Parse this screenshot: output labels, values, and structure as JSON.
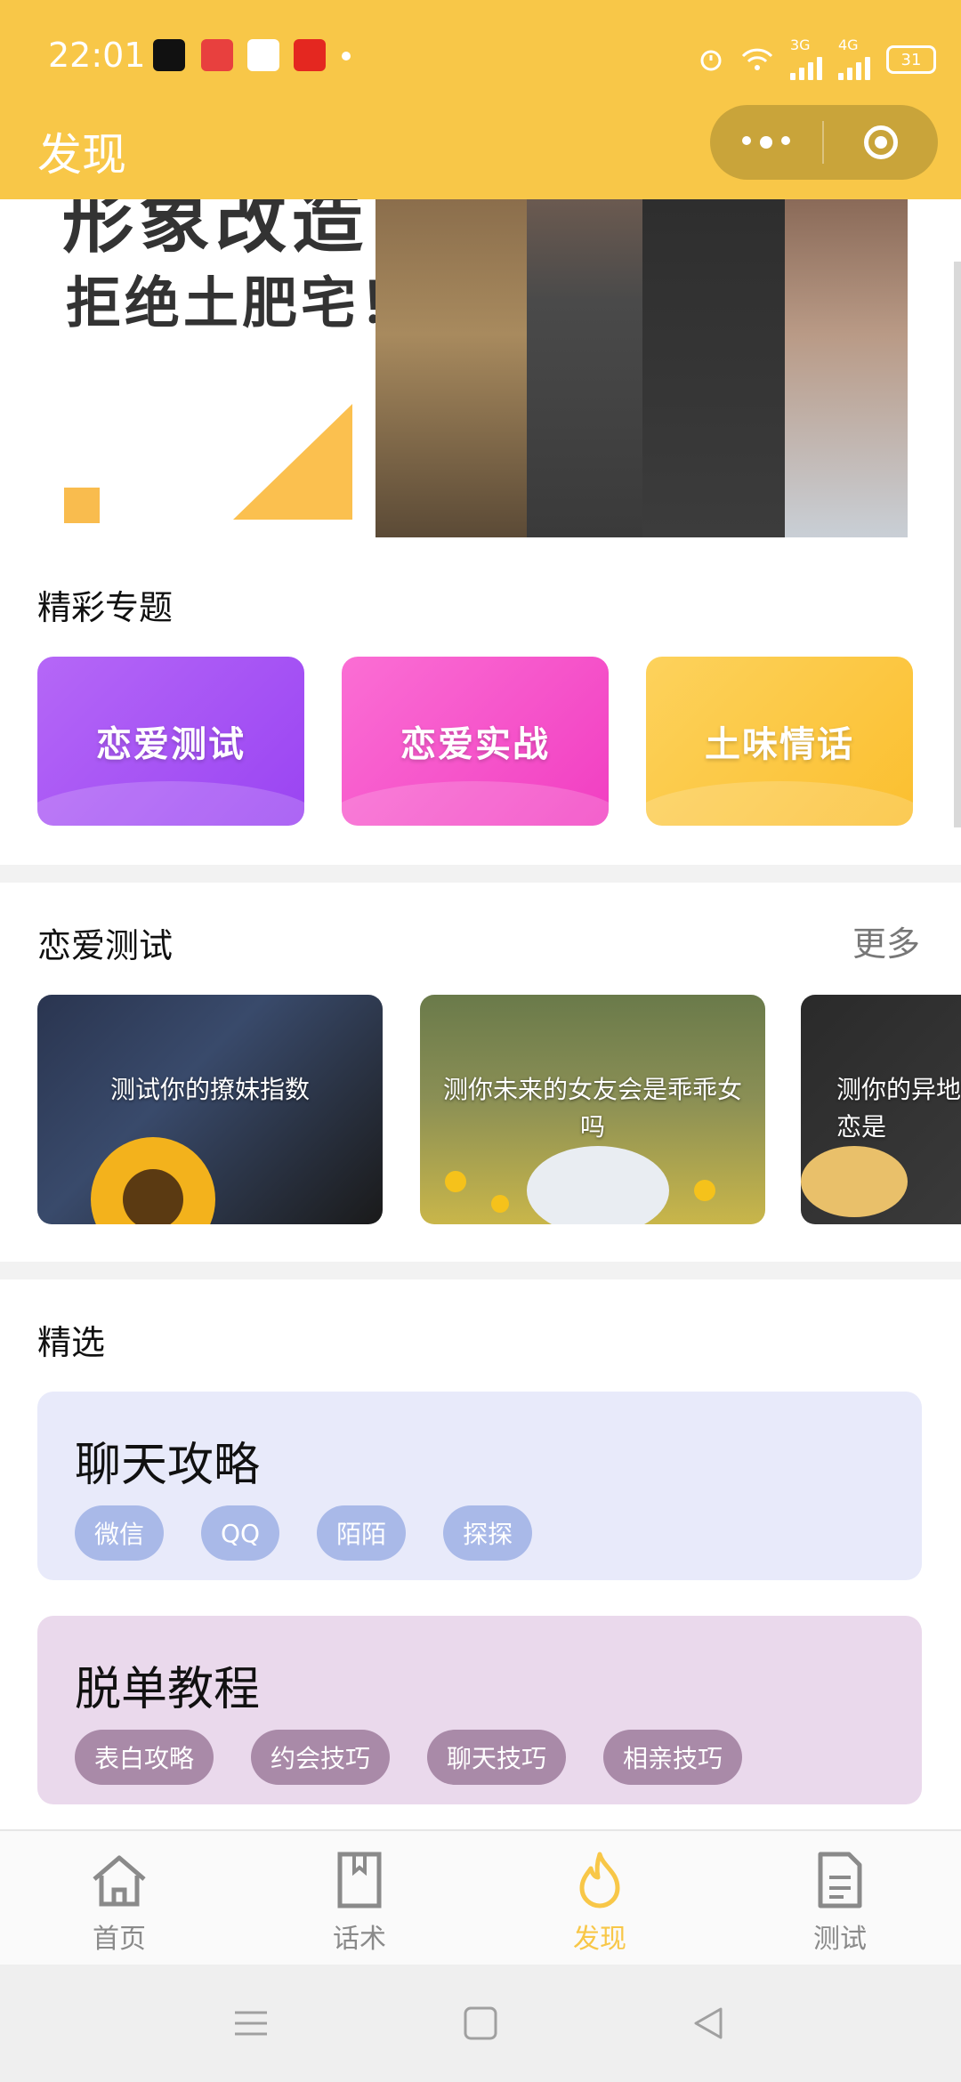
{
  "status_bar": {
    "time": "22:01",
    "network_3g": "3G",
    "network_4g": "4G",
    "battery": "31"
  },
  "header": {
    "title": "发现"
  },
  "banner": {
    "headline_partial": "形象改造",
    "slogan": "拒绝土肥宅！"
  },
  "topics": {
    "title": "精彩专题",
    "items": [
      {
        "label": "恋爱测试",
        "color": "#a450f5"
      },
      {
        "label": "恋爱实战",
        "color": "#f54fc8"
      },
      {
        "label": "土味情话",
        "color": "#fbc53e"
      }
    ]
  },
  "love_tests": {
    "title": "恋爱测试",
    "more_label": "更多",
    "cards": [
      {
        "text": "测试你的撩妹指数"
      },
      {
        "text": "测你未来的女友会是乖乖女吗"
      },
      {
        "text": "测你的异地恋是"
      }
    ]
  },
  "featured": {
    "title": "精选",
    "sections": [
      {
        "title": "聊天攻略",
        "tags": [
          "微信",
          "QQ",
          "陌陌",
          "探探"
        ],
        "bg": "#e8eafa",
        "tag_bg": "#a9b9e8"
      },
      {
        "title": "脱单教程",
        "tags": [
          "表白攻略",
          "约会技巧",
          "聊天技巧",
          "相亲技巧"
        ],
        "bg": "#ead9ec",
        "tag_bg": "#a98aa8"
      }
    ]
  },
  "tabbar": {
    "items": [
      {
        "label": "首页",
        "icon": "home-icon"
      },
      {
        "label": "话术",
        "icon": "book-icon"
      },
      {
        "label": "发现",
        "icon": "flame-icon",
        "active": true
      },
      {
        "label": "测试",
        "icon": "document-icon"
      }
    ]
  },
  "colors": {
    "primary": "#f8c748",
    "inactive_tab": "#8a8a8a"
  }
}
